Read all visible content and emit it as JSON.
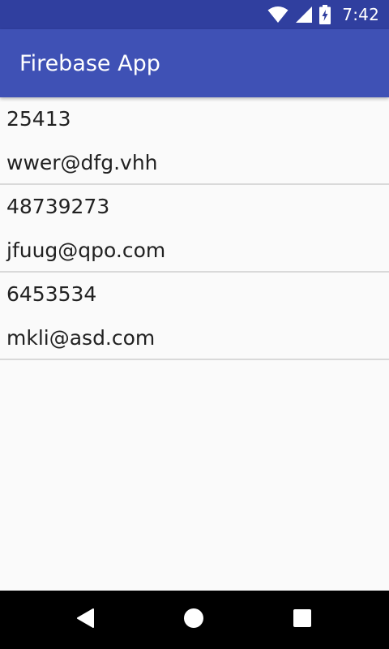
{
  "status_bar": {
    "time": "7:42",
    "icons": [
      "wifi-icon",
      "cellular-signal-icon",
      "battery-charging-icon"
    ]
  },
  "app_bar": {
    "title": "Firebase App"
  },
  "list": {
    "items": [
      {
        "phone": "25413",
        "email": "wwer@dfg.vhh"
      },
      {
        "phone": "48739273",
        "email": "jfuug@qpo.com"
      },
      {
        "phone": "6453534",
        "email": "mkli@asd.com"
      }
    ]
  },
  "nav_bar": {
    "icons": [
      "back-icon",
      "home-icon",
      "recents-icon"
    ]
  },
  "colors": {
    "status_bar": "#303f9f",
    "app_bar": "#3f51b5",
    "background": "#fafafa",
    "divider": "#d9d9d9",
    "text": "#212121"
  }
}
